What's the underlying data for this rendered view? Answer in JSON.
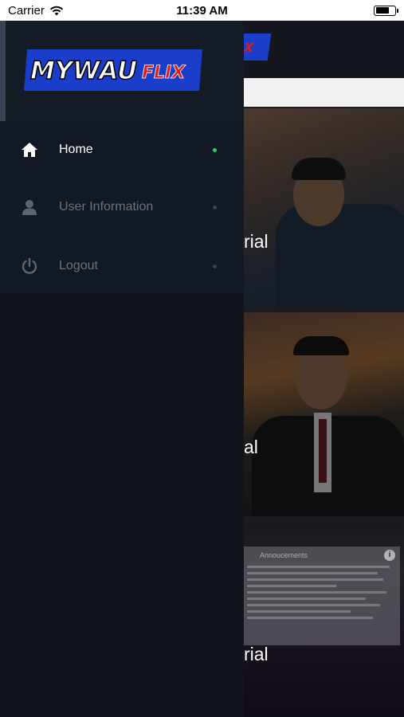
{
  "status_bar": {
    "carrier": "Carrier",
    "time": "11:39 AM"
  },
  "drawer": {
    "logo_text_main": "MYWAU",
    "logo_text_accent": "FLIX",
    "menu": [
      {
        "label": "Home",
        "icon": "home-icon",
        "active": true
      },
      {
        "label": "User Information",
        "icon": "user-icon",
        "active": false
      },
      {
        "label": "Logout",
        "icon": "power-icon",
        "active": false
      }
    ]
  },
  "background": {
    "cards": [
      {
        "title_fragment": "rial"
      },
      {
        "title_fragment": "al"
      },
      {
        "title_fragment": "rial"
      }
    ],
    "announcement_title": "Annoucements",
    "info_icon": "i"
  },
  "colors": {
    "drawer_bg": "#0f141d",
    "active_label": "#ffffff",
    "inactive_label": "#6b7280",
    "active_dot": "#2ecc71",
    "inactive_dot": "#3a4250",
    "logo_bg": "#1a3ec9",
    "logo_accent": "#e01b1b"
  }
}
